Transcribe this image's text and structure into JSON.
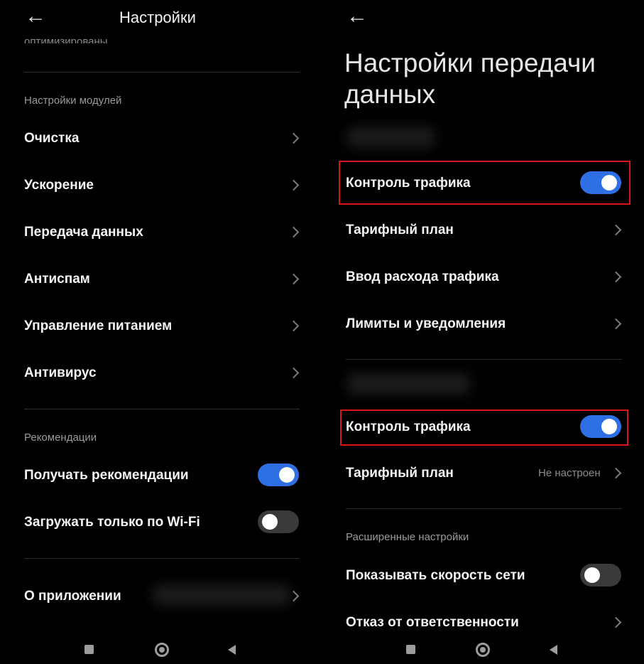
{
  "left": {
    "header_title": "Настройки",
    "partial_top_text": "оптимизированы",
    "modules_section": "Настройки модулей",
    "modules": [
      {
        "label": "Очистка"
      },
      {
        "label": "Ускорение"
      },
      {
        "label": "Передача данных"
      },
      {
        "label": "Антиспам"
      },
      {
        "label": "Управление питанием"
      },
      {
        "label": "Антивирус"
      }
    ],
    "recommend_section": "Рекомендации",
    "get_recommendations": {
      "label": "Получать рекомендации",
      "on": true
    },
    "wifi_only": {
      "label": "Загружать только по Wi-Fi",
      "on": false
    },
    "about": {
      "label": "О приложении"
    }
  },
  "right": {
    "title_line1": "Настройки передачи",
    "title_line2": "данных",
    "sim1": {
      "traffic_control": {
        "label": "Контроль трафика",
        "on": true
      },
      "tariff": {
        "label": "Тарифный план"
      },
      "usage_input": {
        "label": "Ввод расхода трафика"
      },
      "limits": {
        "label": "Лимиты и уведомления"
      }
    },
    "sim2": {
      "traffic_control": {
        "label": "Контроль трафика",
        "on": true
      },
      "tariff": {
        "label": "Тарифный план",
        "value": "Не настроен"
      }
    },
    "advanced_section": "Расширенные настройки",
    "show_speed": {
      "label": "Показывать скорость сети",
      "on": false
    },
    "disclaimer": {
      "label": "Отказ от ответственности"
    }
  },
  "colors": {
    "background": "#000000",
    "toggle_on": "#2f6fe4",
    "toggle_off": "#3a3a3a",
    "highlight": "#d9141b"
  },
  "icons": {
    "back": "arrow-left",
    "chevron": "chevron-right",
    "nav": [
      "square",
      "circle",
      "triangle-left"
    ]
  }
}
